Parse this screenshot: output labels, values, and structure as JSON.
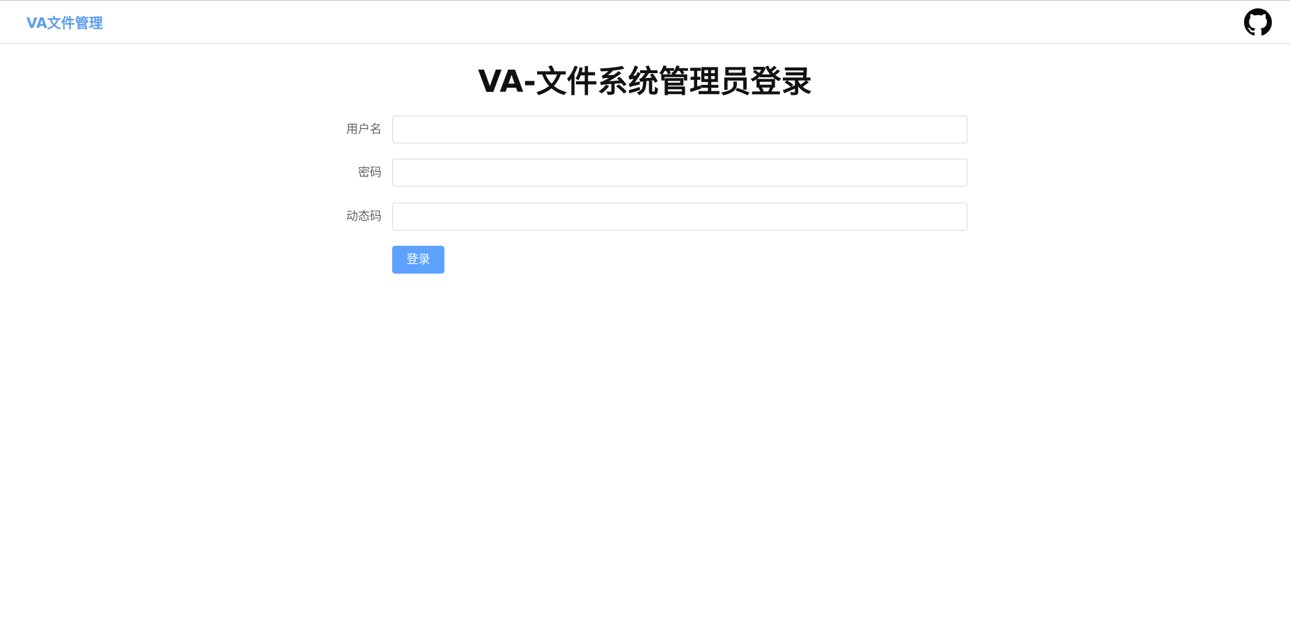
{
  "header": {
    "brand": "VA文件管理",
    "github_icon": "github-icon",
    "brand_color": "#5c9ded"
  },
  "main": {
    "title": "VA-文件系统管理员登录"
  },
  "form": {
    "fields": [
      {
        "label": "用户名",
        "value": "",
        "placeholder": ""
      },
      {
        "label": "密码",
        "value": "",
        "placeholder": ""
      },
      {
        "label": "动态码",
        "value": "",
        "placeholder": ""
      }
    ],
    "submit_label": "登录",
    "submit_color": "#5ea2ff"
  }
}
